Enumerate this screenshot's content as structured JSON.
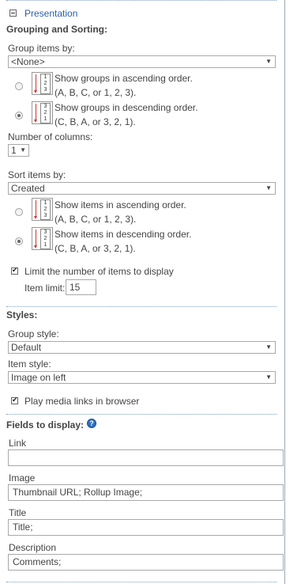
{
  "presentation": {
    "label": "Presentation"
  },
  "grouping": {
    "title": "Grouping and Sorting:",
    "group_by_label": "Group items by:",
    "group_by_value": "<None>",
    "asc_line1": "Show groups in ascending order.",
    "asc_line2": "(A, B, C, or 1, 2, 3).",
    "desc_line1": "Show groups in descending order.",
    "desc_line2": "(C, B, A, or 3, 2, 1).",
    "columns_label": "Number of columns:",
    "columns_value": "1",
    "sort_by_label": "Sort items by:",
    "sort_by_value": "Created",
    "items_asc_line1": "Show items in ascending order.",
    "items_asc_line2": "(A, B, C, or 1, 2, 3).",
    "items_desc_line1": "Show items in descending order.",
    "items_desc_line2": "(C, B, A, or 3, 2, 1).",
    "limit_label": "Limit the number of items to display",
    "item_limit_label": "Item limit:",
    "item_limit_value": "15",
    "icon_asc_digits": [
      "1",
      "2",
      "3"
    ],
    "icon_desc_digits": [
      "3",
      "2",
      "1"
    ]
  },
  "styles": {
    "title": "Styles:",
    "group_style_label": "Group style:",
    "group_style_value": "Default",
    "item_style_label": "Item style:",
    "item_style_value": "Image on left",
    "play_media_label": "Play media links in browser"
  },
  "fields": {
    "title": "Fields to display:",
    "link_label": "Link",
    "link_value": "",
    "image_label": "Image",
    "image_value": "Thumbnail URL; Rollup Image;",
    "title_label": "Title",
    "title_value": "Title;",
    "description_label": "Description",
    "description_value": "Comments;"
  },
  "icons": {
    "collapse": "minus-box-icon",
    "help": "help-question-icon",
    "sort": "sort-order-icon",
    "dropdown": "chevron-down-icon"
  }
}
